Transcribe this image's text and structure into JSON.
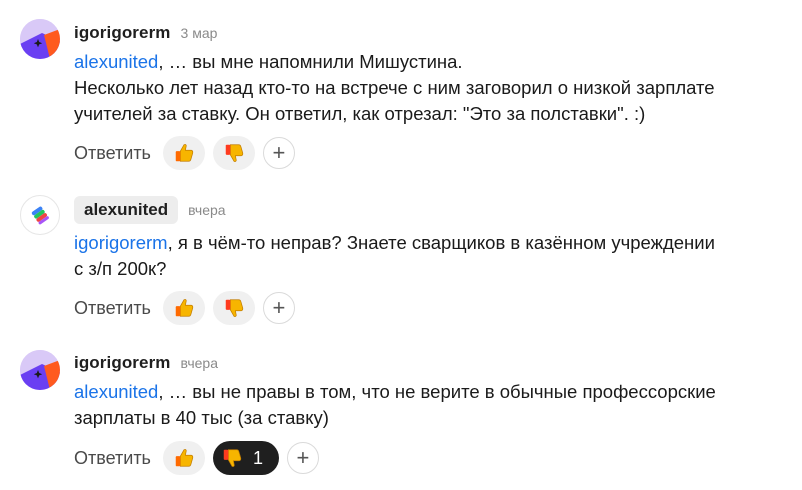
{
  "comments": [
    {
      "author": "igorigorerm",
      "date": "3 мар",
      "mention": "alexunited",
      "line1": ", … вы мне напомнили Мишустина.",
      "line2": "Несколько лет назад кто-то на встрече с ним заговорил о низкой зарплате",
      "line3": "учителей за ставку. Он ответил, как отрезал: \"Это за полставки\". :)",
      "reply_label": "Ответить"
    },
    {
      "author": "alexunited",
      "date": "вчера",
      "mention": "igorigorerm",
      "line1": ", я в чём-то неправ? Знаете сварщиков в казённом учреждении",
      "line2": "с з/п 200к?",
      "reply_label": "Ответить"
    },
    {
      "author": "igorigorerm",
      "date": "вчера",
      "mention": "alexunited",
      "line1": ", … вы не правы в том, что не верите в обычные профессорские",
      "line2": "зарплаты в 40 тыс (за ставку)",
      "reply_label": "Ответить",
      "dislike_count": "1"
    }
  ],
  "add_reaction_symbol": "+",
  "icons": {
    "like": "thumbs-up-icon",
    "dislike": "thumbs-down-icon",
    "add": "plus-icon"
  },
  "colors": {
    "mention": "#1a73e8",
    "active_reaction_bg": "#1f1f1f",
    "reaction_bg": "#f0f0f0"
  }
}
